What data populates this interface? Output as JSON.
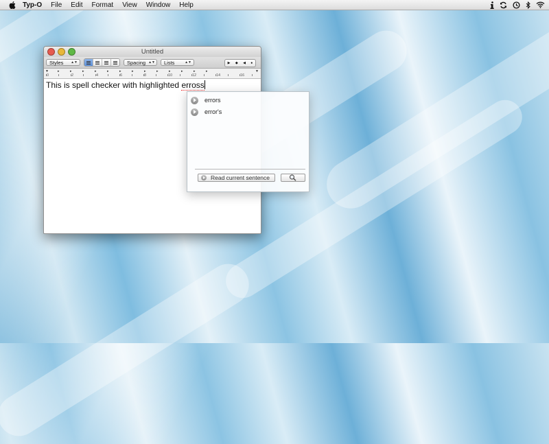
{
  "menubar": {
    "app_name": "Typ-O",
    "items": [
      "File",
      "Edit",
      "Format",
      "View",
      "Window",
      "Help"
    ],
    "status_icons": [
      "info-icon",
      "sync-icon",
      "clock-icon",
      "bluetooth-icon",
      "wifi-icon"
    ]
  },
  "window": {
    "title": "Untitled",
    "toolbar": {
      "styles_label": "Styles",
      "spacing_label": "Spacing",
      "lists_label": "Lists"
    },
    "ruler": [
      "0",
      "2",
      "4",
      "6",
      "8",
      "10",
      "12",
      "14",
      "16"
    ],
    "document": {
      "text_before": "This is spell checker with highlighted ",
      "misspelled_word": "erross"
    }
  },
  "suggestions": {
    "items": [
      {
        "label": "errors"
      },
      {
        "label": "error's"
      }
    ],
    "read_button_label": "Read current sentence"
  },
  "colors": {
    "accent_active": "#5d8fd8",
    "error_underline": "#e33333",
    "close": "#e65b4f",
    "minimize": "#e8b73a",
    "zoom": "#5fb845"
  }
}
